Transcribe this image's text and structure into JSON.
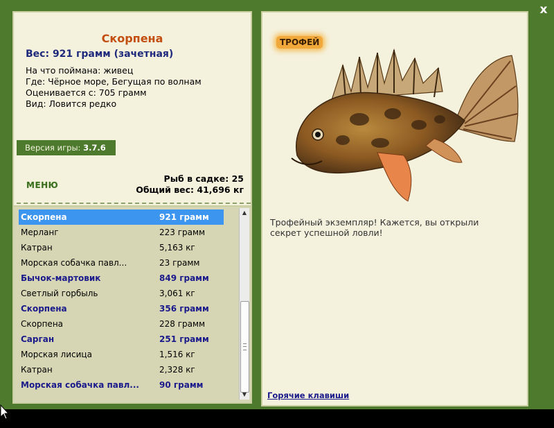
{
  "window": {
    "close_label": "x"
  },
  "fish": {
    "name": "Скорпена",
    "weight_line": "Вес: 921 грамм (зачетная)",
    "caught_on": "На что поймана: живец",
    "location": "Где: Чёрное море, Бегущая по волнам",
    "valued_from": "Оценивается с: 705 грамм",
    "kind": "Вид: Ловится редко"
  },
  "version": {
    "label": "Версия игры:",
    "value": "3.7.6"
  },
  "menu_label": "МЕНЮ",
  "stats": {
    "count_line": "Рыб в садке: 25",
    "total_line": "Общий вес: 41,696 кг"
  },
  "catch_list": [
    {
      "name": "Скорпена",
      "weight": "921 грамм",
      "style": "selected"
    },
    {
      "name": "Мерланг",
      "weight": "223 грамм",
      "style": "normal"
    },
    {
      "name": "Катран",
      "weight": "5,163 кг",
      "style": "normal"
    },
    {
      "name": "Морская собачка павл...",
      "weight": "23 грамм",
      "style": "normal"
    },
    {
      "name": "Бычок-мартовик",
      "weight": "849 грамм",
      "style": "trophy"
    },
    {
      "name": "Светлый горбыль",
      "weight": "3,061 кг",
      "style": "normal"
    },
    {
      "name": "Скорпена",
      "weight": "356 грамм",
      "style": "trophy"
    },
    {
      "name": "Скорпена",
      "weight": "228 грамм",
      "style": "normal"
    },
    {
      "name": "Сарган",
      "weight": "251 грамм",
      "style": "trophy"
    },
    {
      "name": "Морская лисица",
      "weight": "1,516 кг",
      "style": "normal"
    },
    {
      "name": "Катран",
      "weight": "2,328 кг",
      "style": "normal"
    },
    {
      "name": "Морская собачка павл...",
      "weight": "90 грамм",
      "style": "trophy"
    }
  ],
  "trophy_badge": "ТРОФЕЙ",
  "description": "Трофейный экземпляр! Кажется, вы открыли секрет успешной ловли!",
  "hotkeys_link": "Горячие клавиши",
  "colors": {
    "frame": "#4e7a2d",
    "panel": "#f4f1dd",
    "list_bg": "#d6d6b4",
    "selection": "#3c95ee",
    "title": "#c24e0f",
    "trophy_text": "#1a1a8c"
  }
}
